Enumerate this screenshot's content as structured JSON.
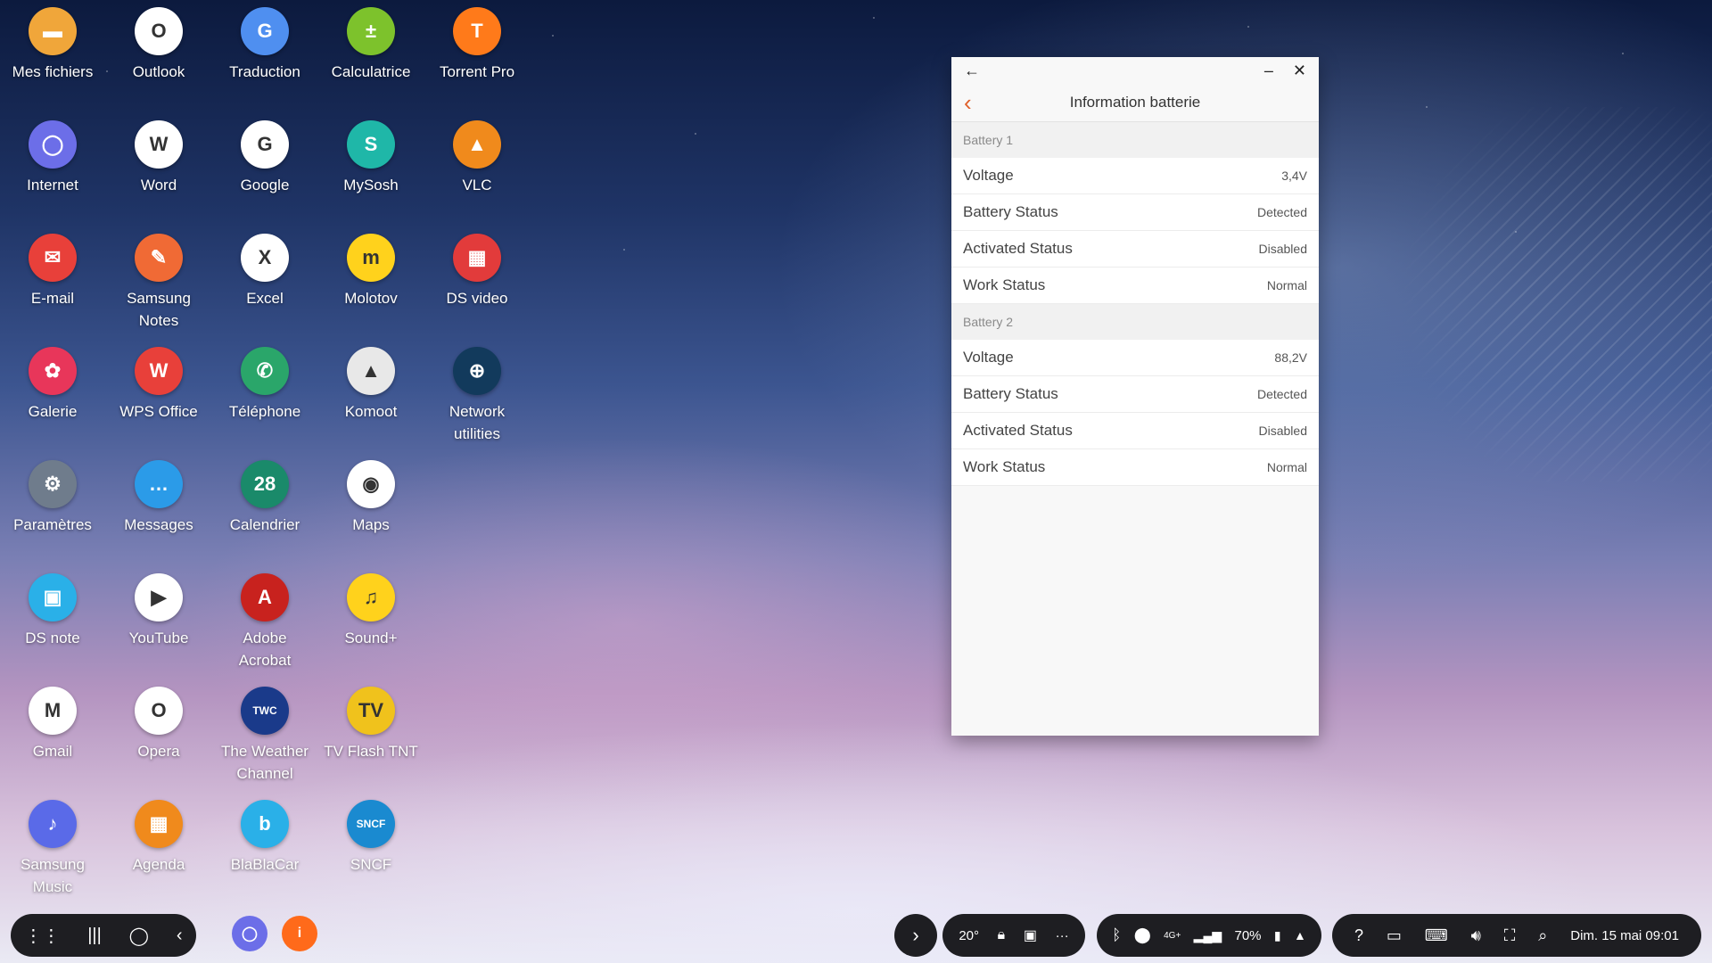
{
  "apps": [
    {
      "label": "Mes fichiers",
      "icon": "folder-icon",
      "color": "#f0a63a",
      "glyph": "▬"
    },
    {
      "label": "Outlook",
      "icon": "outlook-icon",
      "color": "#ffffff",
      "glyph": "O"
    },
    {
      "label": "Traduction",
      "icon": "translate-icon",
      "color": "#4f8ff0",
      "glyph": "G"
    },
    {
      "label": "Calculatrice",
      "icon": "calculator-icon",
      "color": "#7dc22c",
      "glyph": "±"
    },
    {
      "label": "Torrent Pro",
      "icon": "torrent-icon",
      "color": "#ff7a1a",
      "glyph": "T"
    },
    {
      "label": "Internet",
      "icon": "internet-icon",
      "color": "#6c6ee8",
      "glyph": "◯"
    },
    {
      "label": "Word",
      "icon": "word-icon",
      "color": "#ffffff",
      "glyph": "W"
    },
    {
      "label": "Google",
      "icon": "google-icon",
      "color": "#ffffff",
      "glyph": "G"
    },
    {
      "label": "MySosh",
      "icon": "mysosh-icon",
      "color": "#1fb7a8",
      "glyph": "S"
    },
    {
      "label": "VLC",
      "icon": "vlc-icon",
      "color": "#f08a1c",
      "glyph": "▲"
    },
    {
      "label": "E-mail",
      "icon": "email-icon",
      "color": "#e8403a",
      "glyph": "✉"
    },
    {
      "label": "Samsung\nNotes",
      "icon": "notes-icon",
      "color": "#f06a35",
      "glyph": "✎"
    },
    {
      "label": "Excel",
      "icon": "excel-icon",
      "color": "#ffffff",
      "glyph": "X"
    },
    {
      "label": "Molotov",
      "icon": "molotov-icon",
      "color": "#ffd21c",
      "glyph": "m"
    },
    {
      "label": "DS video",
      "icon": "dsvideo-icon",
      "color": "#e23b3b",
      "glyph": "▦"
    },
    {
      "label": "Galerie",
      "icon": "gallery-icon",
      "color": "#e8365a",
      "glyph": "✿"
    },
    {
      "label": "WPS Office",
      "icon": "wps-icon",
      "color": "#e8403a",
      "glyph": "W"
    },
    {
      "label": "Téléphone",
      "icon": "phone-icon",
      "color": "#2aa66a",
      "glyph": "✆"
    },
    {
      "label": "Komoot",
      "icon": "komoot-icon",
      "color": "#e8e8e8",
      "glyph": "▲"
    },
    {
      "label": "Network\nutilities",
      "icon": "network-icon",
      "color": "#123a5c",
      "glyph": "⊕"
    },
    {
      "label": "Paramètres",
      "icon": "settings-icon",
      "color": "#6f7c8c",
      "glyph": "⚙"
    },
    {
      "label": "Messages",
      "icon": "messages-icon",
      "color": "#2b9be8",
      "glyph": "…"
    },
    {
      "label": "Calendrier",
      "icon": "calendar-icon",
      "color": "#1a8a6a",
      "glyph": "28"
    },
    {
      "label": "Maps",
      "icon": "maps-icon",
      "color": "#ffffff",
      "glyph": "◉"
    },
    {
      "label": "DS note",
      "icon": "dsnote-icon",
      "color": "#2ab0e8",
      "glyph": "▣"
    },
    {
      "label": "YouTube",
      "icon": "youtube-icon",
      "color": "#ffffff",
      "glyph": "▶"
    },
    {
      "label": "Adobe\nAcrobat",
      "icon": "acrobat-icon",
      "color": "#c8221e",
      "glyph": "A"
    },
    {
      "label": "Sound+",
      "icon": "sound-icon",
      "color": "#ffd21c",
      "glyph": "♫"
    },
    {
      "label": "Gmail",
      "icon": "gmail-icon",
      "color": "#ffffff",
      "glyph": "M"
    },
    {
      "label": "Opera",
      "icon": "opera-icon",
      "color": "#ffffff",
      "glyph": "O"
    },
    {
      "label": "The Weather\nChannel",
      "icon": "weather-icon",
      "color": "#1a3a8a",
      "glyph": "TWC"
    },
    {
      "label": "TV Flash TNT",
      "icon": "tvflash-icon",
      "color": "#f0c21c",
      "glyph": "TV"
    },
    {
      "label": "Samsung\nMusic",
      "icon": "music-icon",
      "color": "#5a6ae8",
      "glyph": "♪"
    },
    {
      "label": "Agenda",
      "icon": "agenda-icon",
      "color": "#f08a1c",
      "glyph": "▦"
    },
    {
      "label": "BlaBlaCar",
      "icon": "blablacar-icon",
      "color": "#2ab0e8",
      "glyph": "b"
    },
    {
      "label": "SNCF",
      "icon": "sncf-icon",
      "color": "#1a8ad0",
      "glyph": "SNCF"
    }
  ],
  "window": {
    "title": "Information batterie",
    "sections": [
      {
        "label": "Battery 1",
        "rows": [
          {
            "key": "Voltage",
            "value": "3,4V"
          },
          {
            "key": "Battery Status",
            "value": "Detected"
          },
          {
            "key": "Activated Status",
            "value": "Disabled"
          },
          {
            "key": "Work Status",
            "value": "Normal"
          }
        ]
      },
      {
        "label": "Battery 2",
        "rows": [
          {
            "key": "Voltage",
            "value": "88,2V"
          },
          {
            "key": "Battery Status",
            "value": "Detected"
          },
          {
            "key": "Activated Status",
            "value": "Disabled"
          },
          {
            "key": "Work Status",
            "value": "Normal"
          }
        ]
      }
    ]
  },
  "taskbar": {
    "temperature": "20°",
    "more": "···",
    "network": "4G+",
    "battery": "70%",
    "datetime": "Dim. 15 mai 09:01"
  }
}
